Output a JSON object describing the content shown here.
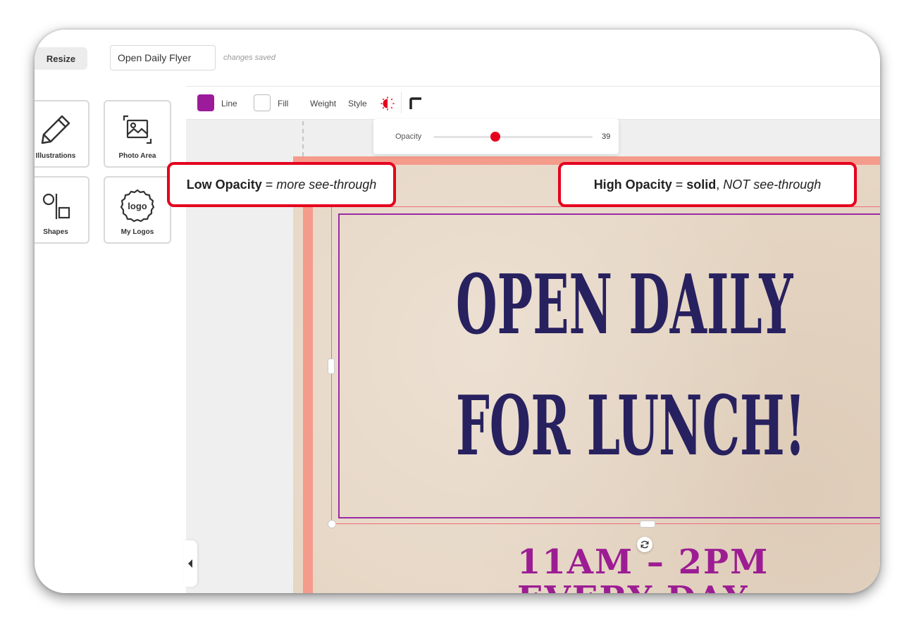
{
  "topbar": {
    "resize_label": "Resize",
    "document_title": "Open Daily Flyer",
    "save_status": "changes saved"
  },
  "sidebar": {
    "tiles": [
      {
        "label": "Illustrations",
        "icon": "pencil-icon"
      },
      {
        "label": "Photo Area",
        "icon": "image-icon"
      },
      {
        "label": "Shapes",
        "icon": "shapes-icon"
      },
      {
        "label": "My Logos",
        "icon": "logo-badge-icon",
        "icon_text": "logo"
      }
    ],
    "collapse_icon": "chevron-left-icon"
  },
  "toolbar": {
    "line_label": "Line",
    "line_color": "#9b1b9a",
    "fill_label": "Fill",
    "fill_color": "#ffffff",
    "weight_label": "Weight",
    "style_label": "Style",
    "opacity_icon": "opacity-icon",
    "corner_icon": "corner-radius-icon"
  },
  "opacity_popover": {
    "label": "Opacity",
    "value": "39",
    "level": 0.39,
    "accent_color": "#e5001e"
  },
  "callouts": {
    "low": {
      "bold": "Low Opacity",
      "sep": " = ",
      "italic": "more see-through"
    },
    "high": {
      "bold1": "High Opacity",
      "sep": " = ",
      "bold2": "solid",
      "comma": ", ",
      "italic": "NOT see-through"
    }
  },
  "flyer": {
    "headline_line1": "OPEN DAILY",
    "headline_line2": "FOR LUNCH!",
    "subline1": "11AM – 2PM",
    "subline2": "EVERY DAY",
    "headline_color": "#28215f",
    "sub_color": "#9c1d93",
    "border_color": "#f49b8c"
  }
}
